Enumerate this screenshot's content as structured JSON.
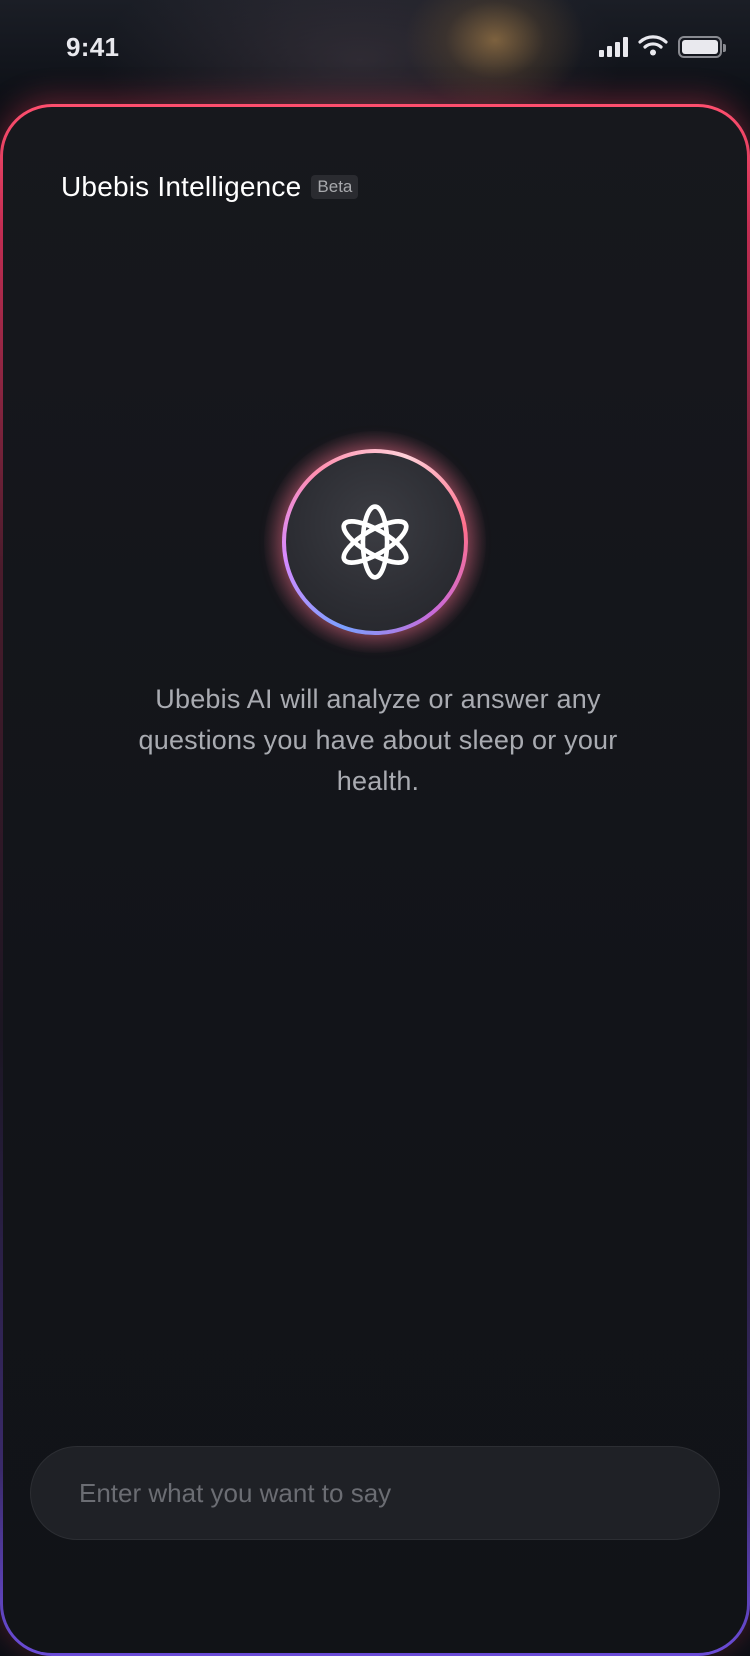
{
  "status_bar": {
    "time": "9:41",
    "icons": [
      "signal-icon",
      "wifi-icon",
      "battery-icon"
    ]
  },
  "header": {
    "title": "Ubebis Intelligence",
    "badge": "Beta"
  },
  "assistant": {
    "icon": "atom-icon",
    "description": "Ubebis AI will analyze or answer any questions you have about sleep or your health."
  },
  "composer": {
    "placeholder": "Enter what you want to say",
    "value": ""
  },
  "colors": {
    "accent_pink": "#ff4f6e",
    "accent_purple": "#6b4cd8",
    "background": "#121419"
  }
}
